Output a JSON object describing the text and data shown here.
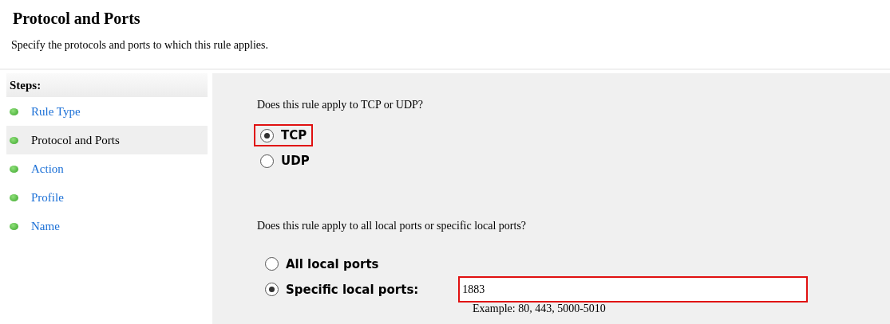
{
  "header": {
    "title": "Protocol and Ports",
    "subtitle": "Specify the protocols and ports to which this rule applies."
  },
  "steps": {
    "heading": "Steps:",
    "items": [
      {
        "label": "Rule Type",
        "selected": false
      },
      {
        "label": "Protocol and Ports",
        "selected": true
      },
      {
        "label": "Action",
        "selected": false
      },
      {
        "label": "Profile",
        "selected": false
      },
      {
        "label": "Name",
        "selected": false
      }
    ]
  },
  "protocol": {
    "question": "Does this rule apply to TCP or UDP?",
    "options": [
      {
        "label": "TCP",
        "selected": true,
        "highlighted": true
      },
      {
        "label": "UDP",
        "selected": false,
        "highlighted": false
      }
    ]
  },
  "ports": {
    "question": "Does this rule apply to all local ports or specific local ports?",
    "options": [
      {
        "label": "All local ports",
        "selected": false
      },
      {
        "label": "Specific local ports:",
        "selected": true
      }
    ],
    "field": {
      "value": "1883",
      "highlighted": true
    },
    "example": "Example: 80, 443, 5000-5010"
  }
}
